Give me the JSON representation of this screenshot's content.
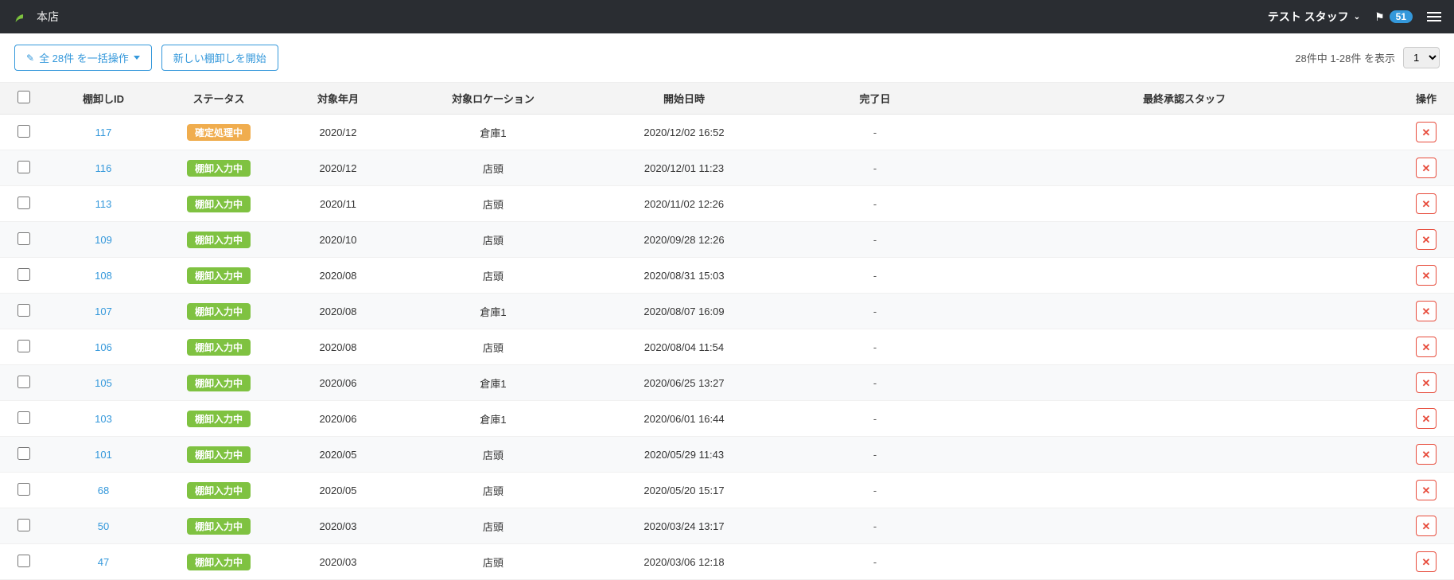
{
  "header": {
    "store_name": "本店",
    "user_name": "テスト スタッフ",
    "notification_count": "51"
  },
  "toolbar": {
    "bulk_label": "全 28件 を一括操作",
    "new_label": "新しい棚卸しを開始",
    "paging_text": "28件中 1-28件 を表示",
    "page_value": "1"
  },
  "columns": {
    "id": "棚卸しID",
    "status": "ステータス",
    "ym": "対象年月",
    "location": "対象ロケーション",
    "start": "開始日時",
    "complete": "完了日",
    "staff": "最終承認スタッフ",
    "ops": "操作"
  },
  "status_labels": {
    "confirming": "確定処理中",
    "entering": "棚卸入力中"
  },
  "rows": [
    {
      "id": "117",
      "status": "confirming",
      "ym": "2020/12",
      "loc": "倉庫1",
      "start": "2020/12/02 16:52",
      "complete": "-",
      "staff": ""
    },
    {
      "id": "116",
      "status": "entering",
      "ym": "2020/12",
      "loc": "店頭",
      "start": "2020/12/01 11:23",
      "complete": "-",
      "staff": ""
    },
    {
      "id": "113",
      "status": "entering",
      "ym": "2020/11",
      "loc": "店頭",
      "start": "2020/11/02 12:26",
      "complete": "-",
      "staff": ""
    },
    {
      "id": "109",
      "status": "entering",
      "ym": "2020/10",
      "loc": "店頭",
      "start": "2020/09/28 12:26",
      "complete": "-",
      "staff": ""
    },
    {
      "id": "108",
      "status": "entering",
      "ym": "2020/08",
      "loc": "店頭",
      "start": "2020/08/31 15:03",
      "complete": "-",
      "staff": ""
    },
    {
      "id": "107",
      "status": "entering",
      "ym": "2020/08",
      "loc": "倉庫1",
      "start": "2020/08/07 16:09",
      "complete": "-",
      "staff": ""
    },
    {
      "id": "106",
      "status": "entering",
      "ym": "2020/08",
      "loc": "店頭",
      "start": "2020/08/04 11:54",
      "complete": "-",
      "staff": ""
    },
    {
      "id": "105",
      "status": "entering",
      "ym": "2020/06",
      "loc": "倉庫1",
      "start": "2020/06/25 13:27",
      "complete": "-",
      "staff": ""
    },
    {
      "id": "103",
      "status": "entering",
      "ym": "2020/06",
      "loc": "倉庫1",
      "start": "2020/06/01 16:44",
      "complete": "-",
      "staff": ""
    },
    {
      "id": "101",
      "status": "entering",
      "ym": "2020/05",
      "loc": "店頭",
      "start": "2020/05/29 11:43",
      "complete": "-",
      "staff": ""
    },
    {
      "id": "68",
      "status": "entering",
      "ym": "2020/05",
      "loc": "店頭",
      "start": "2020/05/20 15:17",
      "complete": "-",
      "staff": ""
    },
    {
      "id": "50",
      "status": "entering",
      "ym": "2020/03",
      "loc": "店頭",
      "start": "2020/03/24 13:17",
      "complete": "-",
      "staff": ""
    },
    {
      "id": "47",
      "status": "entering",
      "ym": "2020/03",
      "loc": "店頭",
      "start": "2020/03/06 12:18",
      "complete": "-",
      "staff": ""
    }
  ]
}
